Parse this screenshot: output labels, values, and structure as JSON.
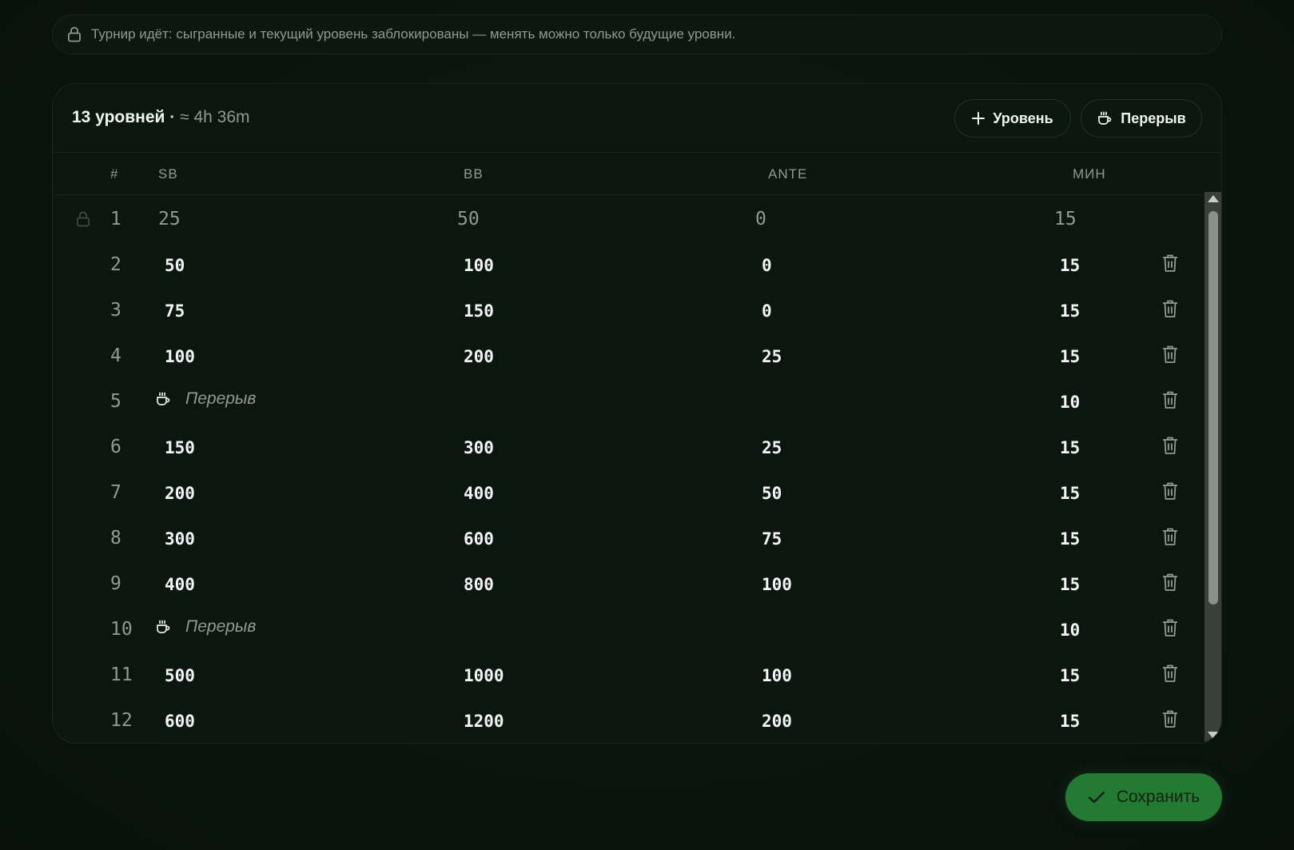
{
  "notice": {
    "icon": "lock-icon",
    "text": "Турнир идёт: сыгранные и текущий уровень заблокированы — менять можно только будущие уровни."
  },
  "header": {
    "count": "13 уровней",
    "separator": "·",
    "duration": "≈ 4h 36m",
    "add_level_label": "Уровень",
    "add_break_label": "Перерыв"
  },
  "columns": {
    "num": "#",
    "sb": "SB",
    "bb": "BB",
    "ante": "ANTE",
    "min": "МИН"
  },
  "rows": [
    {
      "num": "1",
      "sb": "25",
      "bb": "50",
      "ante": "0",
      "min": "15"
    },
    {
      "num": "2",
      "sb": "50",
      "bb": "100",
      "ante": "0",
      "min": "15"
    },
    {
      "num": "3",
      "sb": "75",
      "bb": "150",
      "ante": "0",
      "min": "15"
    },
    {
      "num": "4",
      "sb": "100",
      "bb": "200",
      "ante": "25",
      "min": "15"
    },
    {
      "num": "5",
      "break_label": "Перерыв",
      "min": "10"
    },
    {
      "num": "6",
      "sb": "150",
      "bb": "300",
      "ante": "25",
      "min": "15"
    },
    {
      "num": "7",
      "sb": "200",
      "bb": "400",
      "ante": "50",
      "min": "15"
    },
    {
      "num": "8",
      "sb": "300",
      "bb": "600",
      "ante": "75",
      "min": "15"
    },
    {
      "num": "9",
      "sb": "400",
      "bb": "800",
      "ante": "100",
      "min": "15"
    },
    {
      "num": "10",
      "break_label": "Перерыв",
      "min": "10"
    },
    {
      "num": "11",
      "sb": "500",
      "bb": "1000",
      "ante": "100",
      "min": "15"
    },
    {
      "num": "12",
      "sb": "600",
      "bb": "1200",
      "ante": "200",
      "min": "15"
    }
  ],
  "save_label": "Сохранить",
  "colors": {
    "accent": "#237a33",
    "background": "#0b1610",
    "muted": "#8e9a92"
  }
}
